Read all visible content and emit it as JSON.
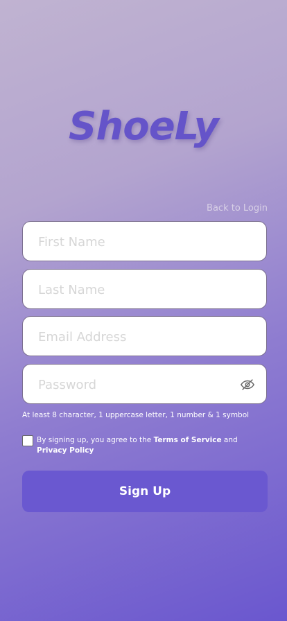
{
  "logo": {
    "text": "ShoeLy"
  },
  "back_link": "Back to Login",
  "form": {
    "first_name": {
      "placeholder": "First Name",
      "value": ""
    },
    "last_name": {
      "placeholder": "Last Name",
      "value": ""
    },
    "email": {
      "placeholder": "Email Address",
      "value": ""
    },
    "password": {
      "placeholder": "Password",
      "value": ""
    },
    "password_hint": "At least 8 character, 1 uppercase letter, 1 number & 1 symbol"
  },
  "terms": {
    "prefix": "By signing up, you agree to the ",
    "tos": "Terms of Service",
    "and": " and",
    "privacy": "Privacy Policy",
    "checked": false
  },
  "signup_button": "Sign Up",
  "icons": {
    "password_toggle": "eye-off-icon"
  },
  "colors": {
    "accent": "#6a58d0",
    "logo": "#6554c9"
  }
}
